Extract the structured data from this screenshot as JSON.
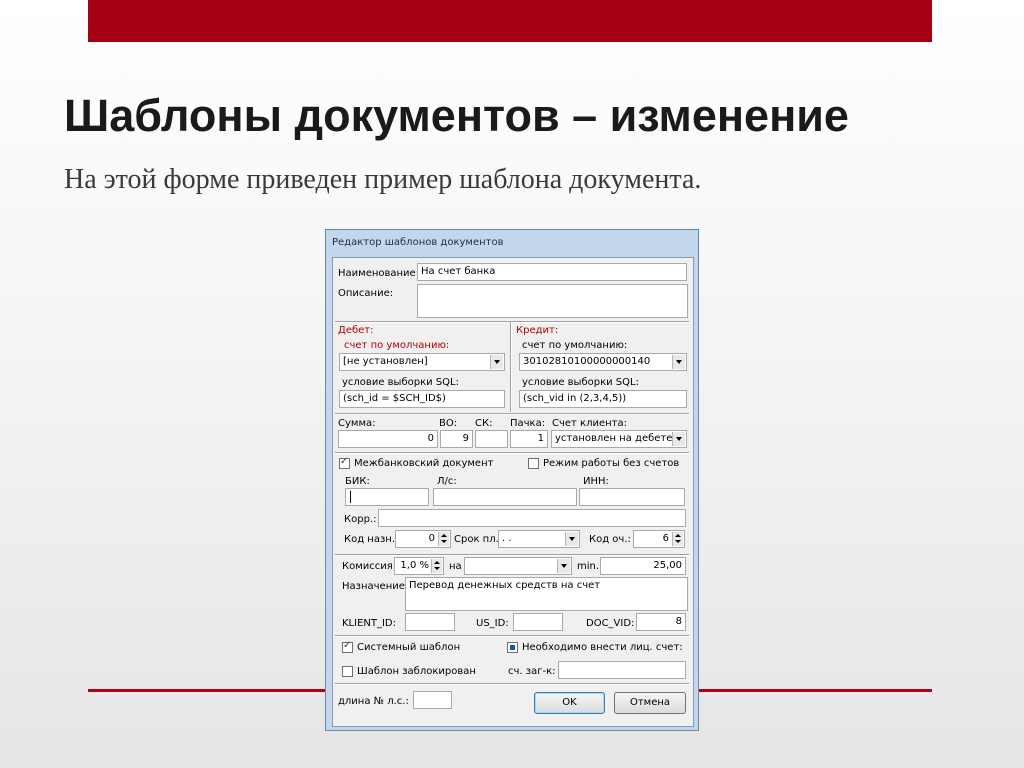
{
  "slide": {
    "title": "Шаблоны документов – изменение",
    "subtitle": "На этой форме приведен пример шаблона документа."
  },
  "window": {
    "title": "Редактор шаблонов документов",
    "name_label": "Наименование:",
    "name_value": "На счет банка",
    "description_label": "Описание:",
    "description_value": "",
    "debit": {
      "header": "Дебет:",
      "default_account_label": "счет по умолчанию:",
      "default_account_value": "[не установлен]",
      "sql_label": "условие выборки SQL:",
      "sql_value": "(sch_id = $SCH_ID$)"
    },
    "credit": {
      "header": "Кредит:",
      "default_account_label": "счет по умолчанию:",
      "default_account_value": "30102810100000000140",
      "sql_label": "условие выборки SQL:",
      "sql_value": "(sch_vid in (2,3,4,5))"
    },
    "amount_label": "Сумма:",
    "amount_value": "0",
    "vo_label": "ВО:",
    "vo_value": "9",
    "sk_label": "СК:",
    "sk_value": "",
    "pack_label": "Пачка:",
    "pack_value": "1",
    "client_account_label": "Счет клиента:",
    "client_account_value": "установлен на дебете",
    "interbank_label": "Межбанковский документ",
    "no_accounts_label": "Режим работы без счетов",
    "bik_label": "БИК:",
    "ls_label": "Л/с:",
    "inn_label": "ИНН:",
    "bik_value": "",
    "ls_value": "",
    "inn_value": "",
    "korr_label": "Корр.:",
    "korr_value": "",
    "kod_nazn_label": "Код назн.:",
    "kod_nazn_value": "0",
    "srok_label": "Срок пл.:",
    "srok_value": ". .",
    "kod_och_label": "Код оч.:",
    "kod_och_value": "6",
    "commission_label": "Комиссия:",
    "commission_value": "1,0 %",
    "na_label": "на",
    "na_value": "",
    "min_label": "min.",
    "min_value": "25,00",
    "purpose_label": "Назначение:",
    "purpose_value": "Перевод денежных средств на счет",
    "klient_id_label": "KLIENT_ID:",
    "klient_id_value": "",
    "us_id_label": "US_ID:",
    "us_id_value": "",
    "doc_vid_label": "DOC_VID:",
    "doc_vid_value": "8",
    "system_template_label": "Системный шаблон",
    "need_personal_account_label": "Необходимо внести лиц. счет:",
    "blocked_label": "Шаблон заблокирован",
    "sch_zagk_label": "сч. заг-к:",
    "sch_zagk_value": "",
    "ls_length_label": "длина № л.с.:",
    "ls_length_value": "",
    "ok_label": "OK",
    "cancel_label": "Отмена"
  },
  "colors": {
    "accent_red": "#a50012",
    "window_frame": "#c3d6ec",
    "label_red": "#b00000"
  },
  "icons": [
    "dropdown-arrow-icon",
    "spin-arrows-icon",
    "checkbox-checked-icon"
  ]
}
